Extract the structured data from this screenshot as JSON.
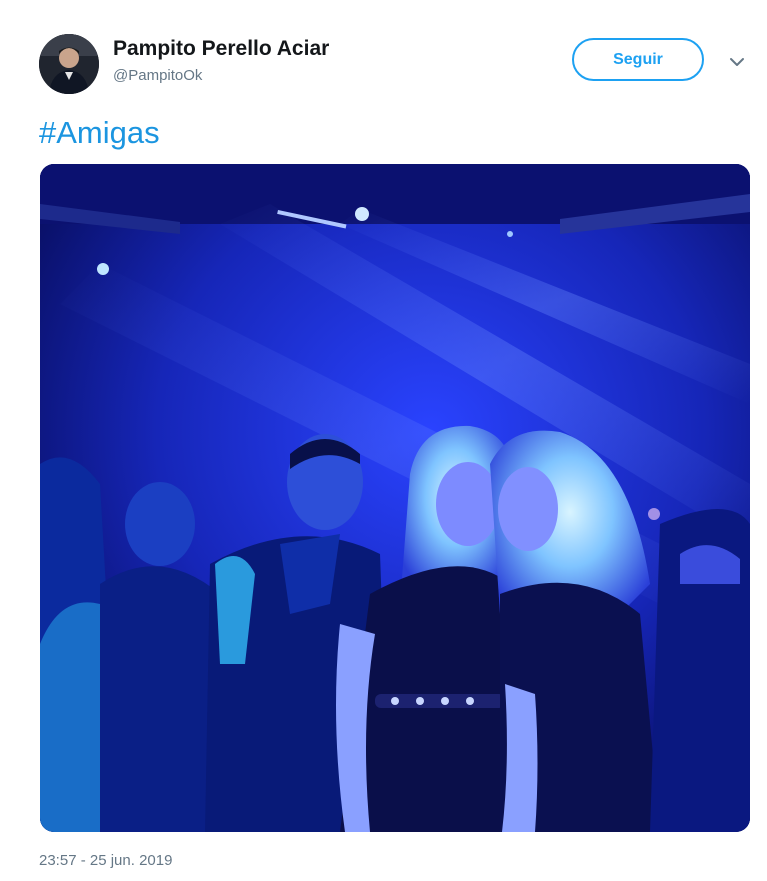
{
  "tweet": {
    "author": {
      "name": "Pampito Perello Aciar",
      "handle": "@PampitoOk",
      "avatar": "avatar-photo"
    },
    "follow_label": "Seguir",
    "menu_icon": "chevron-down-icon",
    "hashtag": "#Amigas",
    "media": {
      "icon": "photo",
      "description_colors": {
        "dominant": "#1a2fd6",
        "dark": "#070b55",
        "highlight": "#7fdcff"
      }
    },
    "timestamp": "23:57 - 25 jun. 2019"
  },
  "colors": {
    "accent": "#1da1f2",
    "link": "#1b95e0",
    "secondary_text": "#657786"
  }
}
